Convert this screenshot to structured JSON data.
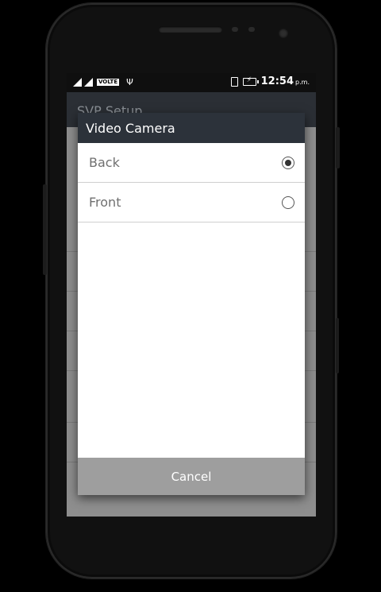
{
  "status_bar": {
    "network_label": "VOLTE",
    "time": "12:54",
    "ampm": "p.m."
  },
  "app_bar": {
    "title": "SVP Setup"
  },
  "dialog": {
    "title": "Video Camera",
    "options": [
      {
        "label": "Back",
        "selected": true
      },
      {
        "label": "Front",
        "selected": false
      }
    ],
    "cancel_label": "Cancel"
  }
}
